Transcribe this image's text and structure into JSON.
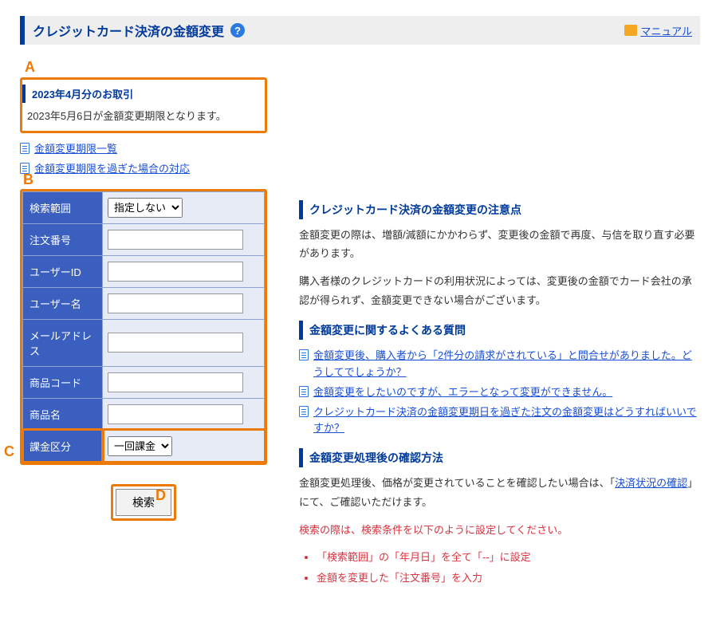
{
  "header": {
    "title": "クレジットカード決済の金額変更",
    "manual_label": "マニュアル"
  },
  "callouts": {
    "A": "A",
    "B": "B",
    "C": "C",
    "D": "D"
  },
  "info": {
    "heading": "2023年4月分のお取引",
    "body": "2023年5月6日が金額変更期限となります。"
  },
  "top_links": [
    "金額変更期限一覧",
    "金額変更期限を過ぎた場合の対応"
  ],
  "form": {
    "rows": [
      {
        "label": "検索範囲",
        "type": "select",
        "value": "指定しない"
      },
      {
        "label": "注文番号",
        "type": "text"
      },
      {
        "label": "ユーザーID",
        "type": "text"
      },
      {
        "label": "ユーザー名",
        "type": "text"
      },
      {
        "label": "メールアドレス",
        "type": "text"
      },
      {
        "label": "商品コード",
        "type": "text"
      },
      {
        "label": "商品名",
        "type": "text"
      }
    ],
    "last_row": {
      "label": "課金区分",
      "type": "select",
      "value": "一回課金"
    },
    "search_button": "検索"
  },
  "notice": {
    "heading": "クレジットカード決済の金額変更の注意点",
    "body1": "金額変更の際は、増額/減額にかかわらず、変更後の金額で再度、与信を取り直す必要があります。",
    "body2": "購入者様のクレジットカードの利用状況によっては、変更後の金額でカード会社の承認が得られず、金額変更できない場合がございます。"
  },
  "faq": {
    "heading": "金額変更に関するよくある質問",
    "items": [
      "金額変更後、購入者から「2件分の請求がされている」と問合せがありました。どうしてでしょうか？",
      "金額変更をしたいのですが、エラーとなって変更ができません。",
      "クレジットカード決済の金額変更期日を過ぎた注文の金額変更はどうすればいいですか？"
    ]
  },
  "confirm": {
    "heading": "金額変更処理後の確認方法",
    "body_pre": "金額変更処理後、価格が変更されていることを確認したい場合は、「",
    "body_link": "決済状況の確認",
    "body_post": "」にて、ご確認いただけます。",
    "red_intro": "検索の際は、検索条件を以下のように設定してください。",
    "red_items": [
      "「検索範囲」の「年月日」を全て「--」に設定",
      "金額を変更した「注文番号」を入力"
    ]
  }
}
